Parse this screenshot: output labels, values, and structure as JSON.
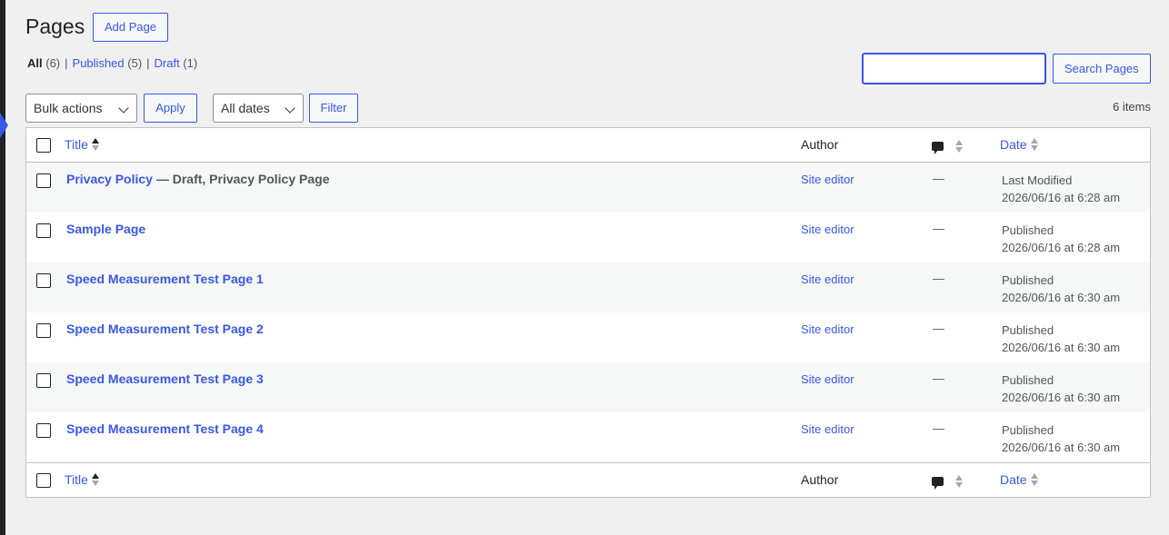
{
  "header": {
    "title": "Pages",
    "add_label": "Add Page"
  },
  "filters": {
    "all": {
      "label": "All",
      "count": "(6)"
    },
    "published": {
      "label": "Published",
      "count": "(5)"
    },
    "draft": {
      "label": "Draft",
      "count": "(1)"
    },
    "separator": "|"
  },
  "search": {
    "value": "",
    "button": "Search Pages"
  },
  "tablenav": {
    "bulk_select": "Bulk actions",
    "apply": "Apply",
    "dates_select": "All dates",
    "filter": "Filter",
    "items_count": "6 items"
  },
  "columns": {
    "title": "Title",
    "author": "Author",
    "date": "Date"
  },
  "rows": [
    {
      "title": "Privacy Policy",
      "state": " — Draft, Privacy Policy Page",
      "author": "Site editor",
      "comments": "—",
      "date_status": "Last Modified",
      "date": "2026/06/16 at 6:28 am"
    },
    {
      "title": "Sample Page",
      "state": "",
      "author": "Site editor",
      "comments": "—",
      "date_status": "Published",
      "date": "2026/06/16 at 6:28 am"
    },
    {
      "title": "Speed Measurement Test Page 1",
      "state": "",
      "author": "Site editor",
      "comments": "—",
      "date_status": "Published",
      "date": "2026/06/16 at 6:30 am"
    },
    {
      "title": "Speed Measurement Test Page 2",
      "state": "",
      "author": "Site editor",
      "comments": "—",
      "date_status": "Published",
      "date": "2026/06/16 at 6:30 am"
    },
    {
      "title": "Speed Measurement Test Page 3",
      "state": "",
      "author": "Site editor",
      "comments": "—",
      "date_status": "Published",
      "date": "2026/06/16 at 6:30 am"
    },
    {
      "title": "Speed Measurement Test Page 4",
      "state": "",
      "author": "Site editor",
      "comments": "—",
      "date_status": "Published",
      "date": "2026/06/16 at 6:30 am"
    }
  ],
  "colors": {
    "accent": "#3858e9",
    "background": "#f0f0f1",
    "text": "#1d2327",
    "muted": "#50575e",
    "border": "#c3c4c7"
  },
  "icons": {
    "comments_column": "comment-bubble-icon",
    "sort": "sort-arrows-icon"
  }
}
